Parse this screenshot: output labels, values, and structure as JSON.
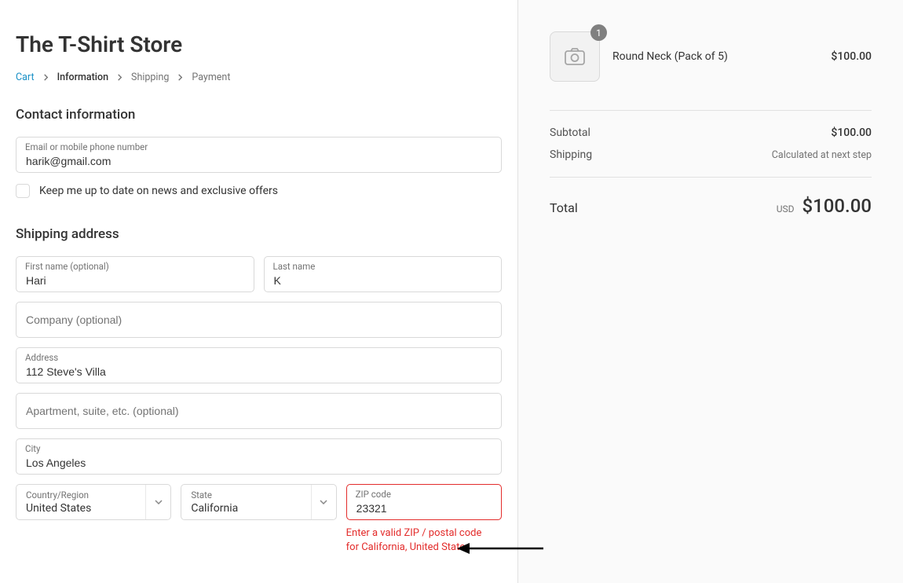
{
  "store_title": "The T-Shirt Store",
  "breadcrumb": {
    "cart": "Cart",
    "information": "Information",
    "shipping": "Shipping",
    "payment": "Payment"
  },
  "contact": {
    "section_title": "Contact information",
    "email_label": "Email or mobile phone number",
    "email_value": "harik@gmail.com",
    "newsletter_label": "Keep me up to date on news and exclusive offers"
  },
  "shipping": {
    "section_title": "Shipping address",
    "first_name_label": "First name (optional)",
    "first_name_value": "Hari",
    "last_name_label": "Last name",
    "last_name_value": "K",
    "company_placeholder": "Company (optional)",
    "address_label": "Address",
    "address_value": "112 Steve's Villa",
    "apt_placeholder": "Apartment, suite, etc. (optional)",
    "city_label": "City",
    "city_value": "Los Angeles",
    "country_label": "Country/Region",
    "country_value": "United States",
    "state_label": "State",
    "state_value": "California",
    "zip_label": "ZIP code",
    "zip_value": "23321",
    "zip_error": "Enter a valid ZIP / postal code for California, United States"
  },
  "cart": {
    "items": [
      {
        "name": "Round Neck (Pack of 5)",
        "price": "$100.00",
        "qty": "1"
      }
    ],
    "subtotal_label": "Subtotal",
    "subtotal_value": "$100.00",
    "shipping_label": "Shipping",
    "shipping_value": "Calculated at next step",
    "total_label": "Total",
    "total_currency": "USD",
    "total_value": "$100.00"
  }
}
